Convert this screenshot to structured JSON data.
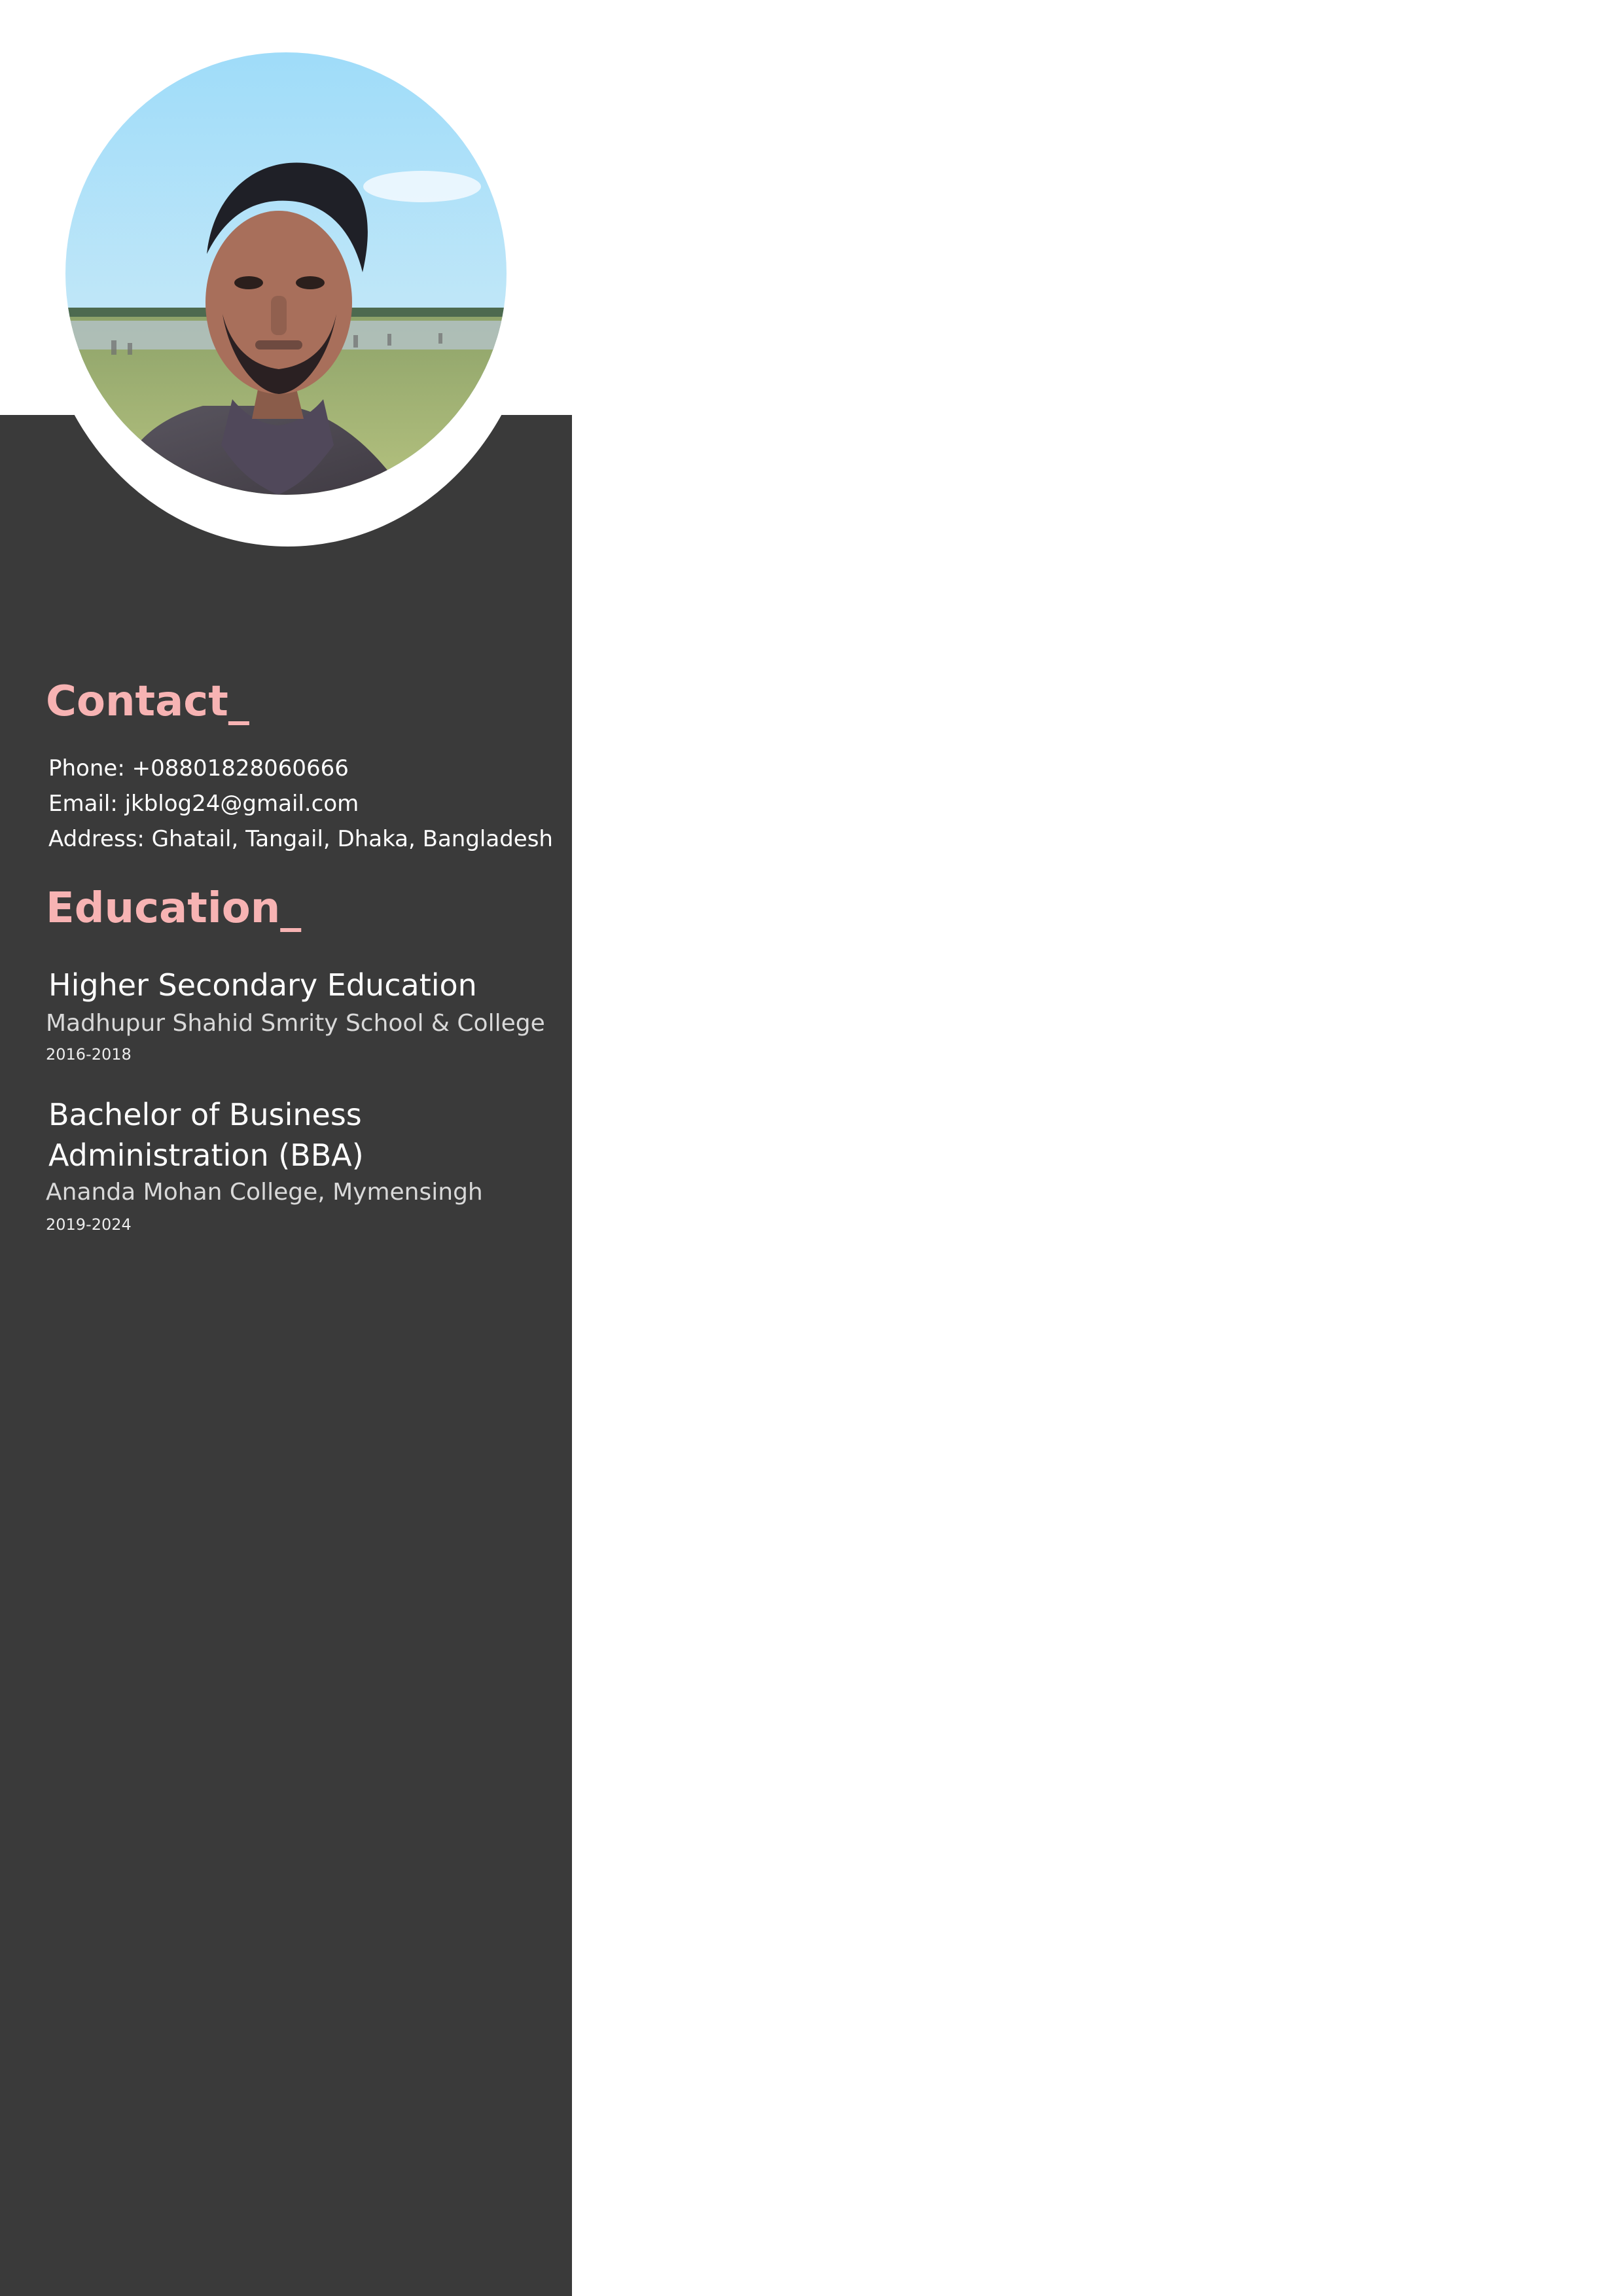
{
  "profile": {
    "photo_icon": "profile-photo"
  },
  "contact": {
    "title": "Contact_",
    "phone": "Phone: +08801828060666",
    "email": "Email: jkblog24@gmail.com",
    "address": "Address: Ghatail, Tangail, Dhaka, Bangladesh"
  },
  "education": {
    "title": "Education_",
    "items": [
      {
        "degree_line1": "Higher Secondary Education",
        "school": "Madhupur Shahid Smrity School & College",
        "years": "2016-2018"
      },
      {
        "degree_line1": "Bachelor of Business",
        "degree_line2": "Administration (BBA)",
        "school": "Ananda Mohan College, Mymensingh",
        "years": "2019-2024"
      }
    ]
  },
  "colors": {
    "sidebar": "#3a3a3a",
    "accent": "#f7b3b3",
    "text": "#ffffff"
  }
}
